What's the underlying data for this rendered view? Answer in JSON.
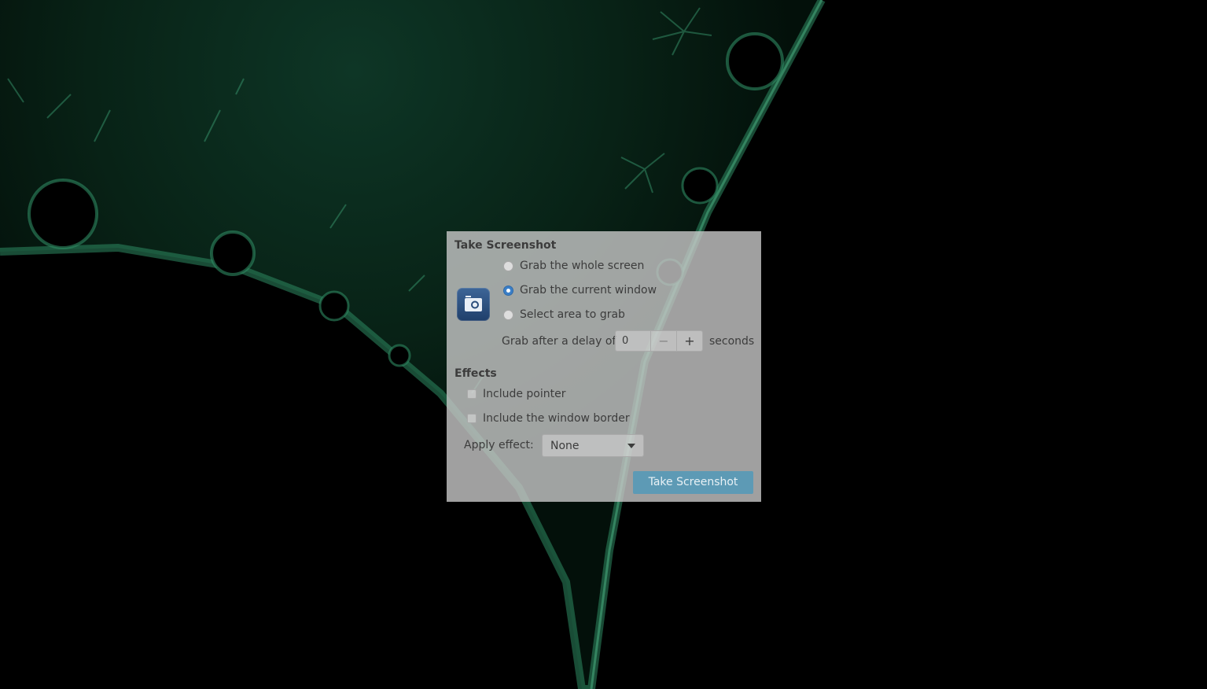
{
  "dialog": {
    "title": "Take Screenshot",
    "grab_options": [
      {
        "label": "Grab the whole screen",
        "selected": false
      },
      {
        "label": "Grab the current window",
        "selected": true
      },
      {
        "label": "Select area to grab",
        "selected": false
      }
    ],
    "delay": {
      "prefix": "Grab after a delay of",
      "value": "0",
      "minus": "−",
      "plus": "+",
      "suffix": "seconds"
    },
    "effects": {
      "title": "Effects",
      "include_pointer": {
        "label": "Include pointer",
        "checked": false
      },
      "include_border": {
        "label": "Include the window border",
        "checked": false
      },
      "apply_effect_label": "Apply effect:",
      "apply_effect_value": "None"
    },
    "take_button_label": "Take Screenshot"
  },
  "icons": {
    "app": "camera-icon"
  },
  "colors": {
    "accent": "#3b7fc8",
    "button": "#5d9ab5",
    "wallpaper_green": "#2e8a63"
  }
}
